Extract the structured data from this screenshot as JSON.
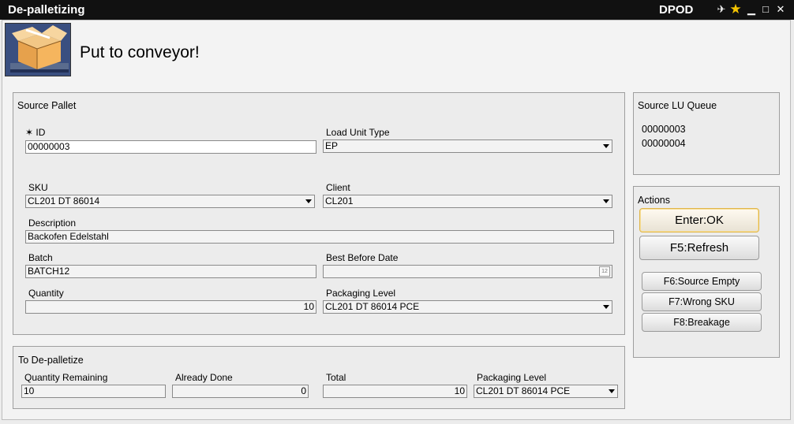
{
  "window": {
    "title": "De-palletizing",
    "app_code": "DPOD",
    "instruction": "Put to conveyor!"
  },
  "titlebar_icons": [
    "pin-icon",
    "star-icon",
    "minimize-icon",
    "maximize-icon",
    "close-icon"
  ],
  "titlebar_glyphs": {
    "pin": "✈",
    "star": "★",
    "minimize": "▁",
    "maximize": "□",
    "close": "✕"
  },
  "colors": {
    "titlebar": "#111111",
    "star": "#f5c400",
    "default_button_border": "#e0b64a"
  },
  "source_pallet": {
    "title": "Source Pallet",
    "id_label": "✶ ID",
    "id_value": "00000003",
    "load_unit_type_label": "Load Unit Type",
    "load_unit_type_value": "EP",
    "sku_label": "SKU",
    "sku_value": "CL201 DT 86014",
    "client_label": "Client",
    "client_value": "CL201",
    "description_label": "Description",
    "description_value": "Backofen Edelstahl",
    "batch_label": "Batch",
    "batch_value": "BATCH12",
    "best_before_label": "Best Before Date",
    "best_before_value": "",
    "quantity_label": "Quantity",
    "quantity_value": "10",
    "packaging_level_label": "Packaging Level",
    "packaging_level_value": "CL201 DT 86014 PCE",
    "calendar_icon_text": "12"
  },
  "to_depalletize": {
    "title": "To De-palletize",
    "qty_remaining_label": "Quantity Remaining",
    "qty_remaining_value": "10",
    "already_done_label": "Already Done",
    "already_done_value": "0",
    "total_label": "Total",
    "total_value": "10",
    "packaging_level_label": "Packaging Level",
    "packaging_level_value": "CL201 DT 86014 PCE"
  },
  "source_lu_queue": {
    "title": "Source LU Queue",
    "items": [
      "00000003",
      "00000004"
    ]
  },
  "actions": {
    "title": "Actions",
    "ok": "Enter:OK",
    "refresh": "F5:Refresh",
    "source_empty": "F6:Source Empty",
    "wrong_sku": "F7:Wrong SKU",
    "breakage": "F8:Breakage"
  }
}
